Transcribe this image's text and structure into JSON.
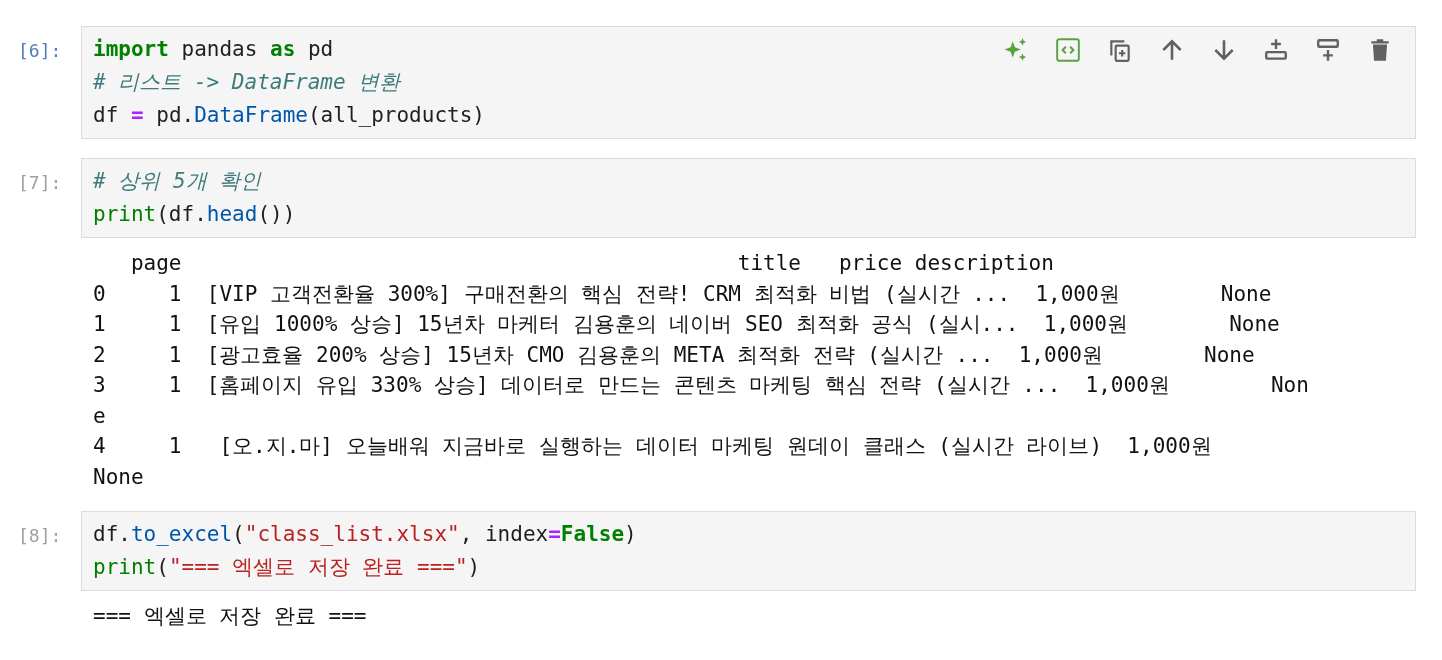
{
  "cells": [
    {
      "prompt": "[6]:",
      "selected": true,
      "code": [
        [
          {
            "kind": "keyword",
            "text": "import"
          },
          {
            "kind": "plain",
            "text": " pandas "
          },
          {
            "kind": "keyword",
            "text": "as"
          },
          {
            "kind": "plain",
            "text": " pd"
          }
        ],
        [
          {
            "kind": "comment",
            "text": "# 리스트 -> DataFrame 변환"
          }
        ],
        [
          {
            "kind": "plain",
            "text": "df "
          },
          {
            "kind": "operator",
            "text": "="
          },
          {
            "kind": "plain",
            "text": " pd."
          },
          {
            "kind": "attribute",
            "text": "DataFrame"
          },
          {
            "kind": "plain",
            "text": "(all_products)"
          }
        ]
      ]
    },
    {
      "prompt": "[7]:",
      "selected": false,
      "code": [
        [
          {
            "kind": "comment",
            "text": "# 상위 5개 확인"
          }
        ],
        [
          {
            "kind": "builtin",
            "text": "print"
          },
          {
            "kind": "plain",
            "text": "(df."
          },
          {
            "kind": "attribute",
            "text": "head"
          },
          {
            "kind": "plain",
            "text": "())"
          }
        ]
      ],
      "output": [
        "   page                                            title   price description",
        "0     1  [VIP 고객전환율 300%] 구매전환의 핵심 전략! CRM 최적화 비법 (실시간 ...  1,000원        None",
        "1     1  [유입 1000% 상승] 15년차 마케터 김용훈의 네이버 SEO 최적화 공식 (실시...  1,000원        None",
        "2     1  [광고효율 200% 상승] 15년차 CMO 김용훈의 META 최적화 전략 (실시간 ...  1,000원        None",
        "3     1  [홈페이지 유입 330% 상승] 데이터로 만드는 콘텐츠 마케팅 핵심 전략 (실시간 ...  1,000원        Non",
        "e",
        "4     1   [오.지.마] 오늘배워 지금바로 실행하는 데이터 마케팅 원데이 클래스 (실시간 라이브)  1,000원",
        "None"
      ]
    },
    {
      "prompt": "[8]:",
      "selected": false,
      "code": [
        [
          {
            "kind": "plain",
            "text": "df."
          },
          {
            "kind": "attribute",
            "text": "to_excel"
          },
          {
            "kind": "plain",
            "text": "("
          },
          {
            "kind": "string",
            "text": "\"class_list.xlsx\""
          },
          {
            "kind": "plain",
            "text": ", index"
          },
          {
            "kind": "operator",
            "text": "="
          },
          {
            "kind": "constant",
            "text": "False"
          },
          {
            "kind": "plain",
            "text": ")"
          }
        ],
        [
          {
            "kind": "builtin",
            "text": "print"
          },
          {
            "kind": "plain",
            "text": "("
          },
          {
            "kind": "string",
            "text": "\"=== 엑셀로 저장 완료 ===\""
          },
          {
            "kind": "plain",
            "text": ")"
          }
        ]
      ],
      "output": [
        "=== 엑셀로 저장 완료 ==="
      ]
    }
  ]
}
